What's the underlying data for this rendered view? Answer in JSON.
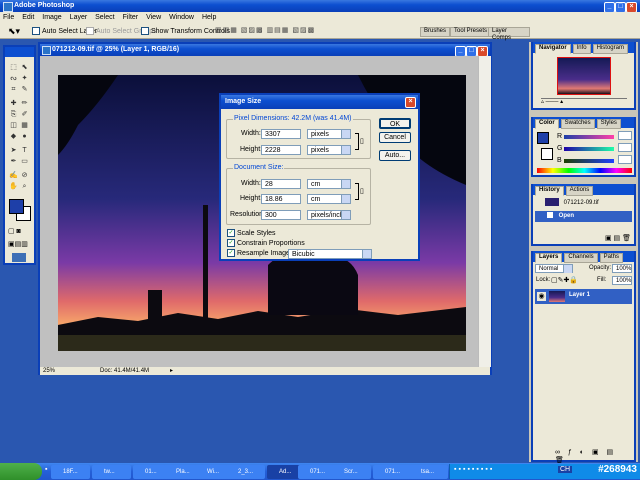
{
  "app": {
    "title": "Adobe Photoshop"
  },
  "menu": [
    "File",
    "Edit",
    "Image",
    "Layer",
    "Select",
    "Filter",
    "View",
    "Window",
    "Help"
  ],
  "options_bar": {
    "auto_select_layer": "Auto Select Layer",
    "auto_select_groups": "Auto Select Groups",
    "show_transform": "Show Transform Controls",
    "well_tabs": [
      "Brushes",
      "Tool Presets",
      "Layer Comps"
    ]
  },
  "document": {
    "title": "071212-09.tif @ 25% (Layer 1, RGB/16)",
    "zoom": "25%",
    "doc_size": "Doc: 41.4M/41.4M"
  },
  "image_size": {
    "title": "Image Size",
    "pixel_dimensions": "Pixel Dimensions: 42.2M (was 41.4M)",
    "width_label": "Width:",
    "height_label": "Height:",
    "width_px": "3307",
    "height_px": "2228",
    "px_unit": "pixels",
    "document_size": "Document Size:",
    "doc_width": "28",
    "doc_height": "18.86",
    "doc_unit": "cm",
    "resolution_label": "Resolution:",
    "resolution": "300",
    "res_unit": "pixels/inch",
    "scale_styles": "Scale Styles",
    "constrain": "Constrain Proportions",
    "resample": "Resample Image:",
    "resample_method": "Bicubic",
    "ok": "OK",
    "cancel": "Cancel",
    "auto": "Auto..."
  },
  "navigator": {
    "tabs": [
      "Navigator",
      "Info",
      "Histogram"
    ]
  },
  "color": {
    "tabs": [
      "Color",
      "Swatches",
      "Styles"
    ],
    "channels": [
      "R",
      "G",
      "B"
    ]
  },
  "history": {
    "tabs": [
      "History",
      "Actions"
    ],
    "items": [
      "071212-09.tif",
      "Open"
    ]
  },
  "layers": {
    "tabs": [
      "Layers",
      "Channels",
      "Paths"
    ],
    "blend_mode": "Normal",
    "opacity_label": "Opacity:",
    "opacity": "100%",
    "lock_label": "Lock:",
    "fill_label": "Fill:",
    "fill": "100%",
    "layer_name": "Layer 1"
  },
  "taskbar": {
    "items": [
      "18F...",
      "tw...",
      "01...",
      "Pla...",
      "Wi...",
      "2_3...",
      "Ad...",
      "071...",
      "Scr...",
      "071...",
      "tsa..."
    ],
    "lang": "CH",
    "watermark": "#268943"
  }
}
